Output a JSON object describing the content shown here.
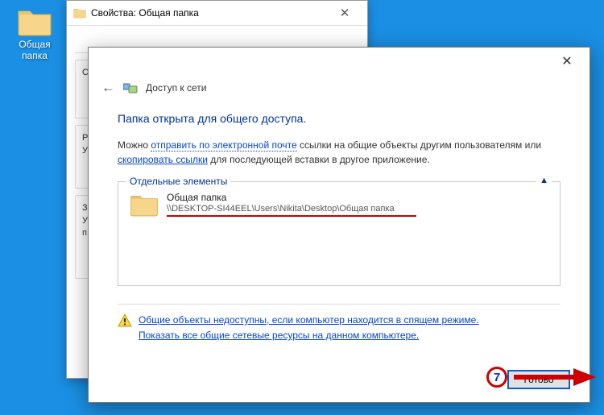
{
  "desktop": {
    "icon_label": "Общая папка"
  },
  "props": {
    "title": "Свойства: Общая папка",
    "g1": "С",
    "g2": "Р\nУ",
    "g3": "З\nУ\nп"
  },
  "share": {
    "nav_title": "Доступ к сети",
    "headline": "Папка открыта для общего доступа.",
    "para_pre": "Можно ",
    "link_email": "отправить по электронной почте",
    "para_mid1": " ссылки на общие объекты другим пользователям или ",
    "link_copy": "скопировать ссылки",
    "para_post": " для последующей вставки в другое приложение.",
    "legend": "Отдельные элементы",
    "expand": "▲",
    "item_name": "Общая папка",
    "item_path": "\\\\DESKTOP-SI44EEL\\Users\\Nikita\\Desktop\\Общая папка",
    "link_unavail": "Общие объекты недоступны, если компьютер находится в спящем режиме.",
    "link_all": "Показать все общие сетевые ресурсы на данном компьютере.",
    "done": "Готово"
  },
  "callout": "7"
}
